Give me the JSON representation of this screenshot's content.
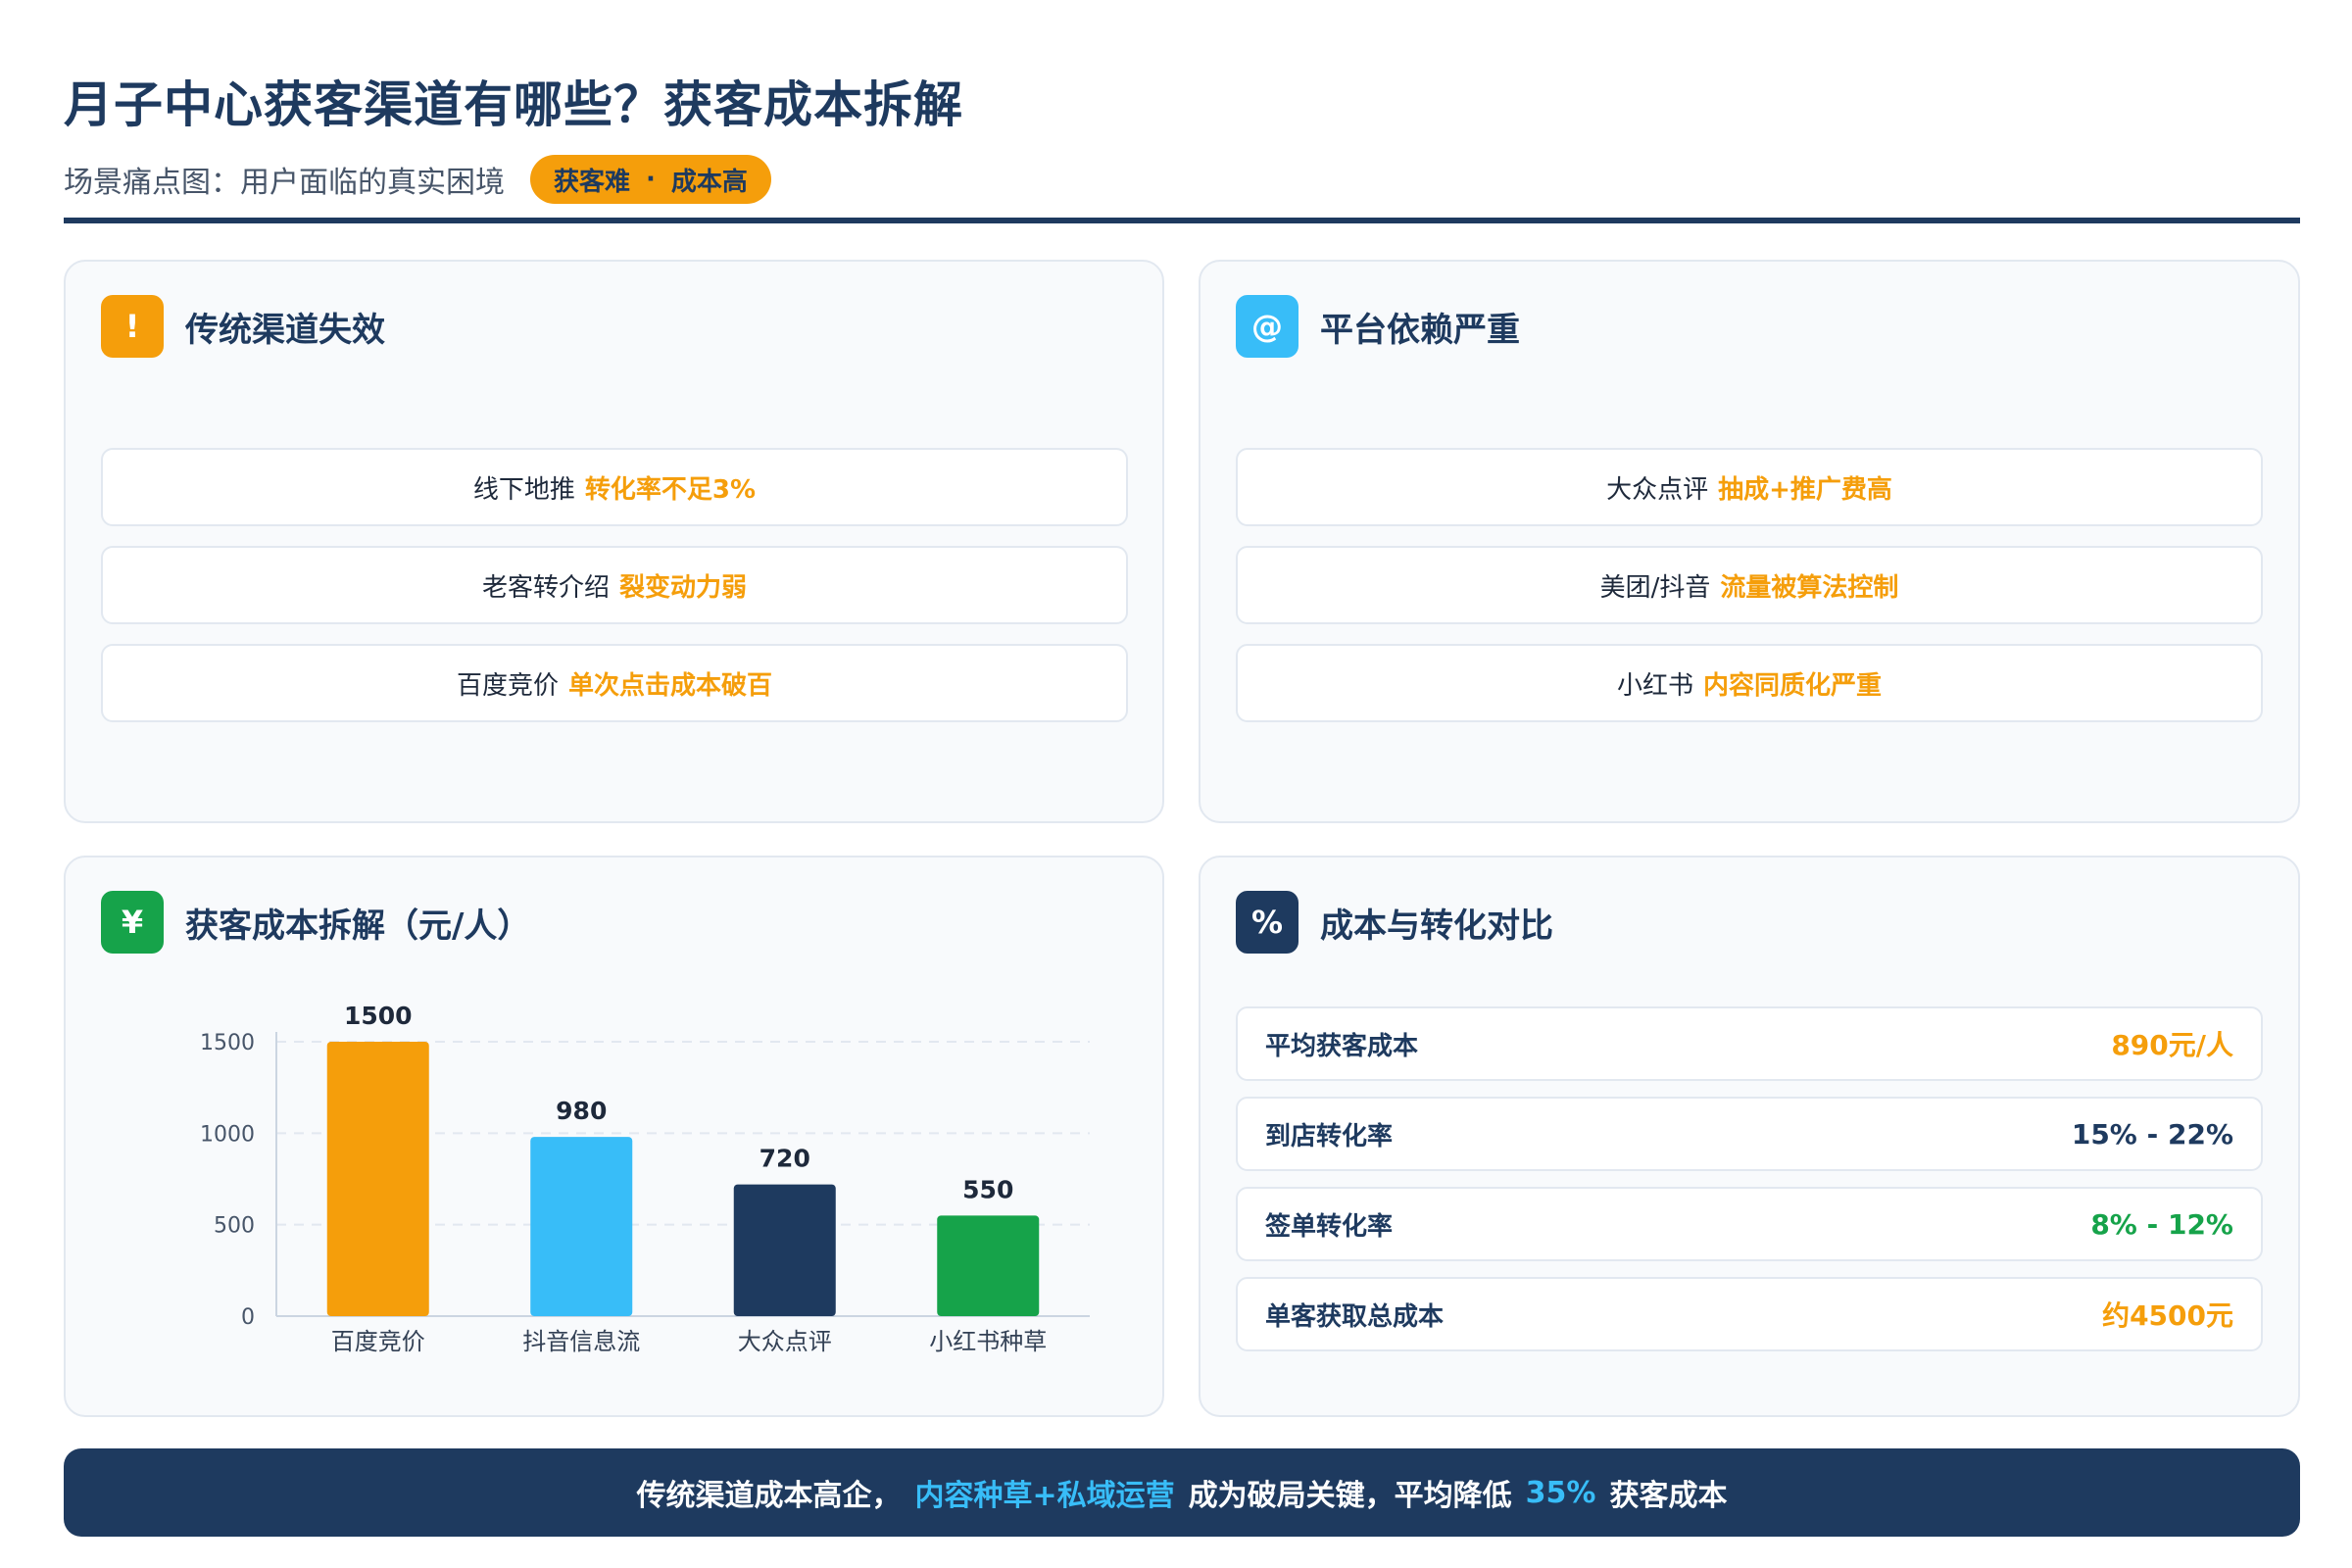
{
  "header": {
    "title": "月子中心获客渠道有哪些？获客成本拆解",
    "subtitle": "场景痛点图：用户面临的真实困境",
    "badge_left": "获客难",
    "badge_dot": "·",
    "badge_right": "成本高"
  },
  "panels": {
    "traditional": {
      "icon_glyph": "!",
      "icon_color": "#f59e0b",
      "title": "传统渠道失效",
      "items": [
        {
          "label": "线下地推",
          "highlight": "转化率不足3%"
        },
        {
          "label": "老客转介绍",
          "highlight": "裂变动力弱"
        },
        {
          "label": "百度竞价",
          "highlight": "单次点击成本破百"
        }
      ]
    },
    "platform": {
      "icon_glyph": "@",
      "icon_color": "#38bdf8",
      "title": "平台依赖严重",
      "items": [
        {
          "label": "大众点评",
          "highlight": "抽成+推广费高"
        },
        {
          "label": "美团/抖音",
          "highlight": "流量被算法控制"
        },
        {
          "label": "小红书",
          "highlight": "内容同质化严重"
        }
      ]
    },
    "cost": {
      "icon_glyph": "¥",
      "icon_color": "#16a34a",
      "title": "获客成本拆解（元/人）"
    },
    "compare": {
      "icon_glyph": "%",
      "icon_color": "#1e3a5f",
      "title": "成本与转化对比",
      "metrics": [
        {
          "label": "平均获客成本",
          "value": "890元/人",
          "color": "#f59e0b"
        },
        {
          "label": "到店转化率",
          "value": "15% - 22%",
          "color": "#1e3a5f"
        },
        {
          "label": "签单转化率",
          "value": "8% - 12%",
          "color": "#16a34a"
        },
        {
          "label": "单客获取总成本",
          "value": "约4500元",
          "color": "#f59e0b"
        }
      ]
    }
  },
  "chart_data": {
    "type": "bar",
    "categories": [
      "百度竞价",
      "抖音信息流",
      "大众点评",
      "小红书种草"
    ],
    "values": [
      1500,
      980,
      720,
      550
    ],
    "colors": [
      "#f59e0b",
      "#38bdf8",
      "#1e3a5f",
      "#16a34a"
    ],
    "yticks": [
      0,
      500,
      1000,
      1500
    ],
    "ylim": [
      0,
      1500
    ],
    "grid": true,
    "title": "",
    "xlabel": "",
    "ylabel": ""
  },
  "footer": {
    "part1": "传统渠道成本高企，",
    "accent1": "内容种草+私域运营",
    "part2": "成为破局关键，平均降低",
    "accent2": "35%",
    "part3": "获客成本"
  }
}
